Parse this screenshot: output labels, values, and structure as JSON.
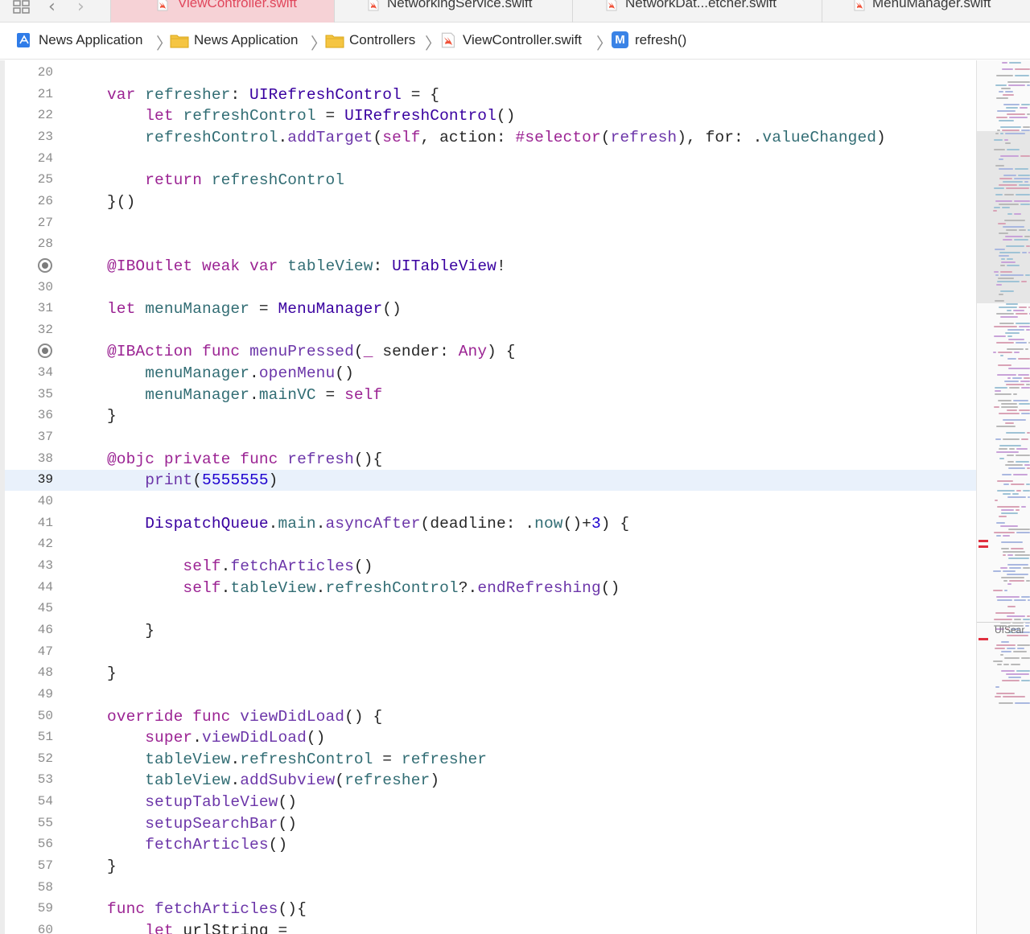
{
  "tabs": [
    {
      "label": "ViewController.swift",
      "active": true
    },
    {
      "label": "NetworkingService.swift",
      "active": false
    },
    {
      "label": "NetworkDat...etcher.swift",
      "active": false
    },
    {
      "label": "MenuManager.swift",
      "active": false
    }
  ],
  "breadcrumb": {
    "project": "News Application",
    "group": "News Application",
    "folder": "Controllers",
    "file": "ViewController.swift",
    "method_badge": "M",
    "method": "refresh()"
  },
  "editor": {
    "current_line": 39,
    "lines": [
      {
        "n": "20",
        "code": ""
      },
      {
        "n": "21",
        "code": "var refresher: UIRefreshControl = {"
      },
      {
        "n": "22",
        "code": "    let refreshControl = UIRefreshControl()"
      },
      {
        "n": "23",
        "code": "    refreshControl.addTarget(self, action: #selector(refresh), for: .valueChanged)"
      },
      {
        "n": "24",
        "code": ""
      },
      {
        "n": "25",
        "code": "    return refreshControl"
      },
      {
        "n": "26",
        "code": "}()"
      },
      {
        "n": "27",
        "code": ""
      },
      {
        "n": "28",
        "code": ""
      },
      {
        "n": "",
        "code": "@IBOutlet weak var tableView: UITableView!",
        "breakpoint": true
      },
      {
        "n": "30",
        "code": ""
      },
      {
        "n": "31",
        "code": "let menuManager = MenuManager()"
      },
      {
        "n": "32",
        "code": ""
      },
      {
        "n": "",
        "code": "@IBAction func menuPressed(_ sender: Any) {",
        "breakpoint": true
      },
      {
        "n": "34",
        "code": "    menuManager.openMenu()"
      },
      {
        "n": "35",
        "code": "    menuManager.mainVC = self"
      },
      {
        "n": "36",
        "code": "}"
      },
      {
        "n": "37",
        "code": ""
      },
      {
        "n": "38",
        "code": "@objc private func refresh(){"
      },
      {
        "n": "39",
        "code": "    print(5555555)"
      },
      {
        "n": "40",
        "code": ""
      },
      {
        "n": "41",
        "code": "    DispatchQueue.main.asyncAfter(deadline: .now()+3) {"
      },
      {
        "n": "42",
        "code": ""
      },
      {
        "n": "43",
        "code": "        self.fetchArticles()"
      },
      {
        "n": "44",
        "code": "        self.tableView.refreshControl?.endRefreshing()"
      },
      {
        "n": "45",
        "code": ""
      },
      {
        "n": "46",
        "code": "    }"
      },
      {
        "n": "47",
        "code": ""
      },
      {
        "n": "48",
        "code": "}"
      },
      {
        "n": "49",
        "code": ""
      },
      {
        "n": "50",
        "code": "override func viewDidLoad() {"
      },
      {
        "n": "51",
        "code": "    super.viewDidLoad()"
      },
      {
        "n": "52",
        "code": "    tableView.refreshControl = refresher"
      },
      {
        "n": "53",
        "code": "    tableView.addSubview(refresher)"
      },
      {
        "n": "54",
        "code": "    setupTableView()"
      },
      {
        "n": "55",
        "code": "    setupSearchBar()"
      },
      {
        "n": "56",
        "code": "    fetchArticles()"
      },
      {
        "n": "57",
        "code": "}"
      },
      {
        "n": "58",
        "code": ""
      },
      {
        "n": "59",
        "code": "func fetchArticles(){"
      },
      {
        "n": "60",
        "code": "    let urlString ="
      }
    ]
  },
  "minimap": {
    "label": "UISear"
  },
  "colors": {
    "keyword": "#9b2393",
    "type": "#3900a0",
    "property": "#326d74",
    "function": "#6c36a9",
    "number": "#1c00cf",
    "attribute": "#643820",
    "active_tab_bg": "#f6d2d6",
    "active_tab_text": "#e0475c",
    "current_line_bg": "#e9f1fb",
    "minimap_marker": "#e0303f"
  },
  "icons": {
    "swift_file": "swift-icon",
    "folder": "folder-icon",
    "project": "xcode-project-icon",
    "method": "method-icon"
  }
}
